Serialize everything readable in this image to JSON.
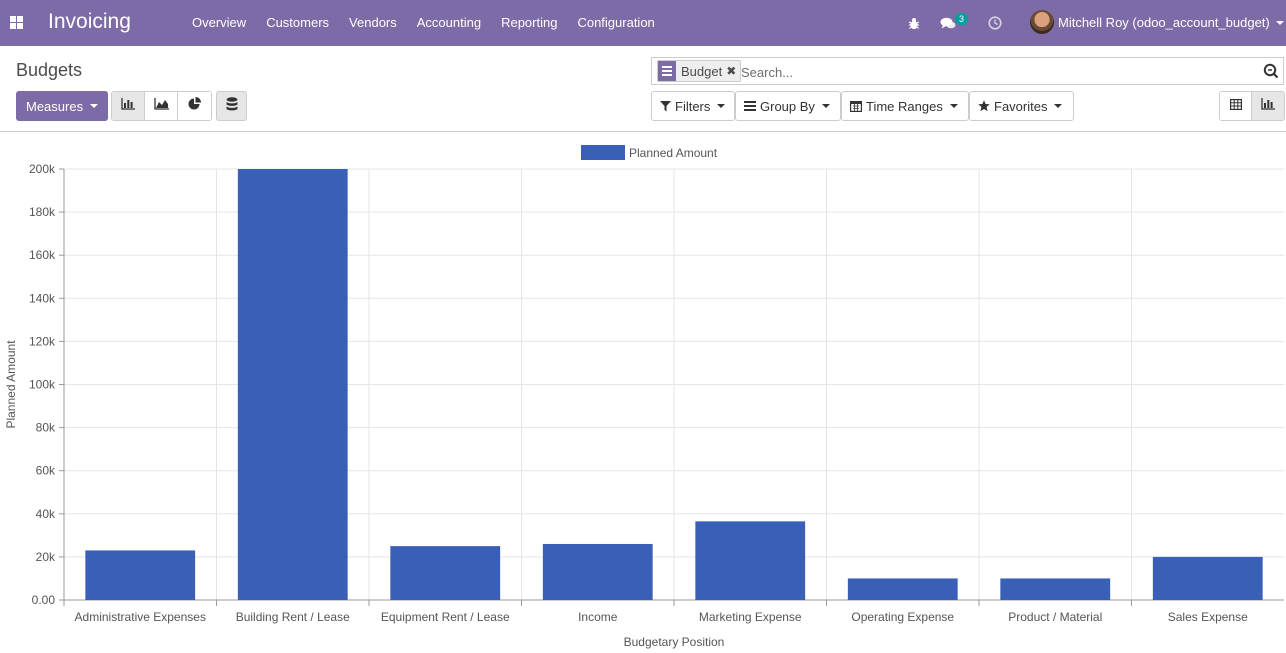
{
  "app": {
    "title": "Invoicing",
    "apps_icon": "apps-grid-icon"
  },
  "menu": [
    "Overview",
    "Customers",
    "Vendors",
    "Accounting",
    "Reporting",
    "Configuration"
  ],
  "systray": {
    "chat_count": "3",
    "user_name": "Mitchell Roy (odoo_account_budget)"
  },
  "page": {
    "title": "Budgets"
  },
  "search": {
    "facet_value": "Budget",
    "placeholder": "Search..."
  },
  "buttons": {
    "measures": "Measures",
    "filters": "Filters",
    "group_by": "Group By",
    "time_ranges": "Time Ranges",
    "favorites": "Favorites"
  },
  "colors": {
    "navbar": "#7c6ba7",
    "bar": "#3a5fb6",
    "badge": "#00a09d"
  },
  "chart_data": {
    "type": "bar",
    "categories": [
      "Administrative Expenses",
      "Building Rent / Lease",
      "Equipment Rent / Lease",
      "Income",
      "Marketing Expense",
      "Operating Expense",
      "Product / Material",
      "Sales Expense"
    ],
    "series": [
      {
        "name": "Planned Amount",
        "values": [
          23000,
          200000,
          25000,
          26000,
          36500,
          10000,
          10000,
          20000
        ]
      }
    ],
    "xlabel": "Budgetary Position",
    "ylabel": "Planned Amount",
    "ylim": [
      0,
      200000
    ],
    "yticks": [
      "0.00",
      "20k",
      "40k",
      "60k",
      "80k",
      "100k",
      "120k",
      "140k",
      "160k",
      "180k",
      "200k"
    ],
    "legend": "top-center",
    "grid": true
  }
}
